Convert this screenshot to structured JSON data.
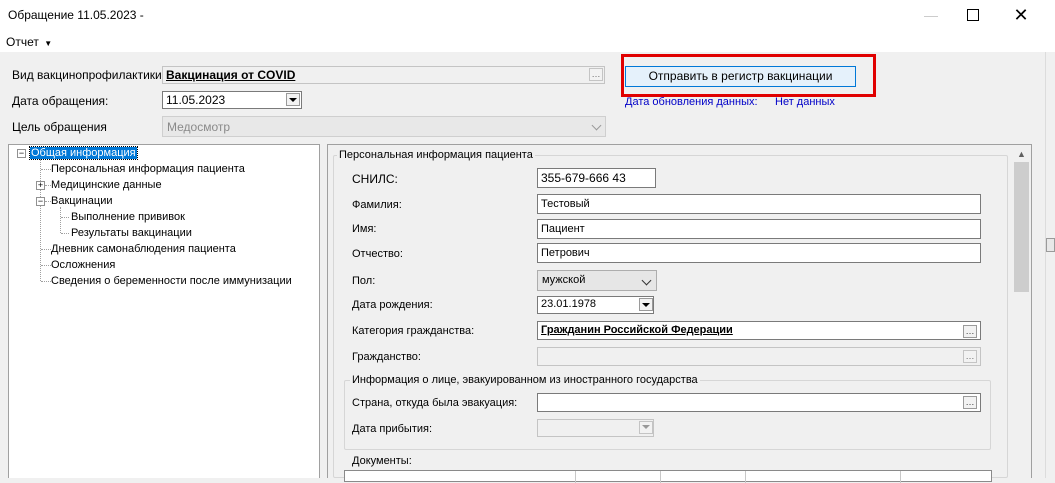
{
  "window": {
    "title": "Обращение 11.05.2023 -",
    "minimize_icon": "minimize-icon",
    "maximize_icon": "maximize-icon",
    "close_icon": "close-icon"
  },
  "menu": {
    "report": "Отчет"
  },
  "header": {
    "vaccination_type_label": "Вид вакцинопрофилактики:",
    "vaccination_type_value": "Вакцинация от COVID",
    "date_label": "Дата обращения:",
    "date_value": "11.05.2023",
    "purpose_label": "Цель обращения",
    "purpose_value": "Медосмотр",
    "send_button": "Отправить в регистр вакцинации",
    "update_date_label": "Дата обновления данных:",
    "update_date_value": "Нет данных"
  },
  "tree": {
    "items": [
      {
        "label": "Общая информация"
      },
      {
        "label": "Персональная информация пациента"
      },
      {
        "label": "Медицинские данные"
      },
      {
        "label": "Вакцинации"
      },
      {
        "label": "Выполнение прививок"
      },
      {
        "label": "Результаты вакцинации"
      },
      {
        "label": "Дневник самонаблюдения пациента"
      },
      {
        "label": "Осложнения"
      },
      {
        "label": "Сведения о беременности после иммунизации"
      }
    ]
  },
  "personal": {
    "group_title": "Персональная информация пациента",
    "snils_label": "СНИЛС:",
    "snils_value": "355-679-666 43",
    "surname_label": "Фамилия:",
    "surname_value": "Тестовый",
    "name_label": "Имя:",
    "name_value": "Пациент",
    "patronymic_label": "Отчество:",
    "patronymic_value": "Петрович",
    "sex_label": "Пол:",
    "sex_value": "мужской",
    "birth_label": "Дата рождения:",
    "birth_value": "23.01.1978",
    "citizen_cat_label": "Категория гражданства:",
    "citizen_cat_value": "Гражданин Российской Федерации",
    "citizenship_label": "Гражданство:",
    "citizenship_value": "",
    "evac_group_title": "Информация о лице, эвакуированном из иностранного государства",
    "evac_country_label": "Страна, откуда была эвакуация:",
    "evac_country_value": "",
    "arrival_label": "Дата прибытия:",
    "arrival_value": "",
    "documents_label": "Документы:"
  },
  "colors": {
    "accent": "#0078d7",
    "highlight_box": "#e00000",
    "link": "#0000c8"
  }
}
